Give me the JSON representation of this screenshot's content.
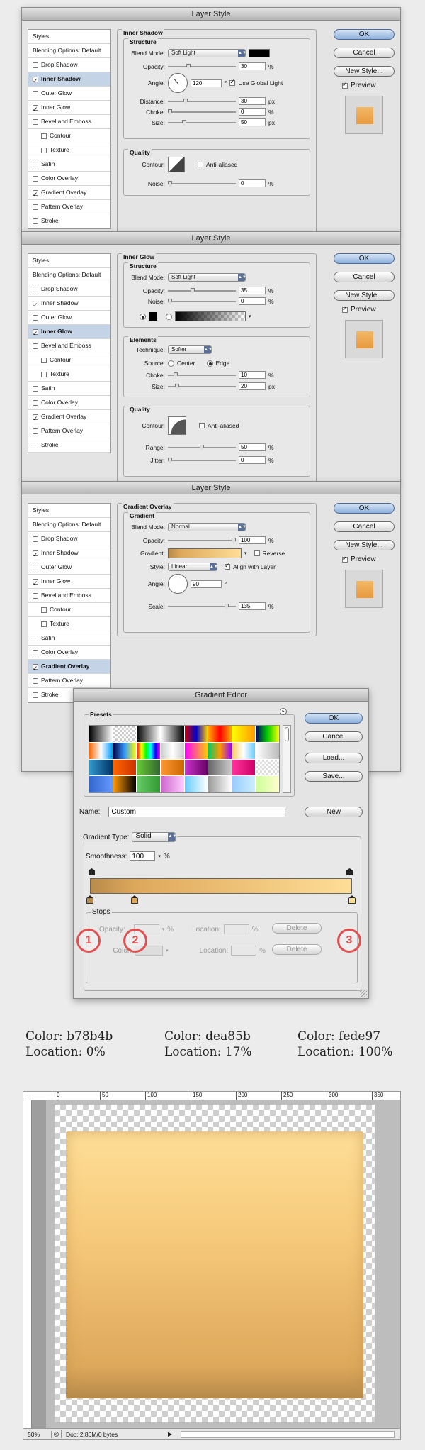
{
  "dialog1": {
    "title": "Layer Style",
    "styles": [
      {
        "label": "Styles",
        "checked": null
      },
      {
        "label": "Blending Options: Default",
        "checked": null
      },
      {
        "label": "Drop Shadow",
        "checked": false
      },
      {
        "label": "Inner Shadow",
        "checked": true,
        "selected": true
      },
      {
        "label": "Outer Glow",
        "checked": false
      },
      {
        "label": "Inner Glow",
        "checked": true
      },
      {
        "label": "Bevel and Emboss",
        "checked": false
      },
      {
        "label": "Contour",
        "checked": false,
        "indent": true
      },
      {
        "label": "Texture",
        "checked": false,
        "indent": true
      },
      {
        "label": "Satin",
        "checked": false
      },
      {
        "label": "Color Overlay",
        "checked": false
      },
      {
        "label": "Gradient Overlay",
        "checked": true
      },
      {
        "label": "Pattern Overlay",
        "checked": false
      },
      {
        "label": "Stroke",
        "checked": false
      }
    ],
    "section_title": "Inner Shadow",
    "structure_title": "Structure",
    "blend_mode_label": "Blend Mode:",
    "blend_mode": "Soft Light",
    "opacity_label": "Opacity:",
    "opacity": "30",
    "angle_label": "Angle:",
    "angle": "120",
    "use_global_light": "Use Global Light",
    "distance_label": "Distance:",
    "distance": "30",
    "choke_label": "Choke:",
    "choke": "0",
    "size_label": "Size:",
    "size": "50",
    "quality_title": "Quality",
    "contour_label": "Contour:",
    "anti_aliased": "Anti-aliased",
    "noise_label": "Noise:",
    "noise": "0",
    "pct": "%",
    "px": "px",
    "deg": "°"
  },
  "dialog2": {
    "title": "Layer Style",
    "section_title": "Inner Glow",
    "structure_title": "Structure",
    "blend_mode_label": "Blend Mode:",
    "blend_mode": "Soft Light",
    "opacity_label": "Opacity:",
    "opacity": "35",
    "noise_label": "Noise:",
    "noise": "0",
    "elements_title": "Elements",
    "technique_label": "Technique:",
    "technique": "Softer",
    "source_label": "Source:",
    "source_center": "Center",
    "source_edge": "Edge",
    "choke_label": "Choke:",
    "choke": "10",
    "size_label": "Size:",
    "size": "20",
    "quality_title": "Quality",
    "contour_label": "Contour:",
    "anti_aliased": "Anti-aliased",
    "range_label": "Range:",
    "range": "50",
    "jitter_label": "Jitter:",
    "jitter": "0"
  },
  "dialog3": {
    "title": "Layer Style",
    "section_title": "Gradient Overlay",
    "gradient_title": "Gradient",
    "blend_mode_label": "Blend Mode:",
    "blend_mode": "Normal",
    "opacity_label": "Opacity:",
    "opacity": "100",
    "gradient_label": "Gradient:",
    "reverse": "Reverse",
    "style_label": "Style:",
    "style": "Linear",
    "align_with_layer": "Align with Layer",
    "angle_label": "Angle:",
    "angle": "90",
    "scale_label": "Scale:",
    "scale": "135"
  },
  "buttons": {
    "ok": "OK",
    "cancel": "Cancel",
    "new_style": "New Style...",
    "preview": "Preview"
  },
  "gradient_editor": {
    "title": "Gradient Editor",
    "presets_label": "Presets",
    "ok": "OK",
    "cancel": "Cancel",
    "load": "Load...",
    "save": "Save...",
    "name_label": "Name:",
    "name_value": "Custom",
    "new_button": "New",
    "gradient_type_label": "Gradient Type:",
    "gradient_type": "Solid",
    "smoothness_label": "Smoothness:",
    "smoothness": "100",
    "pct": "%",
    "stops_label": "Stops",
    "opacity_label": "Opacity:",
    "location_label": "Location:",
    "color_label": "Color:",
    "delete": "Delete",
    "markers": [
      "1",
      "2",
      "3"
    ]
  },
  "color_stops": [
    {
      "color_label": "Color: b78b4b",
      "location_label": "Location: 0%",
      "hex": "#b78b4b",
      "location": 0
    },
    {
      "color_label": "Color: dea85b",
      "location_label": "Location: 17%",
      "hex": "#dea85b",
      "location": 17
    },
    {
      "color_label": "Color: fede97",
      "location_label": "Location: 100%",
      "hex": "#fede97",
      "location": 100
    }
  ],
  "canvas_window": {
    "ruler_labels": [
      "0",
      "50",
      "100",
      "150",
      "200",
      "250",
      "300",
      "350"
    ],
    "zoom": "50%",
    "doc_info": "Doc: 2.86M/0 bytes"
  }
}
